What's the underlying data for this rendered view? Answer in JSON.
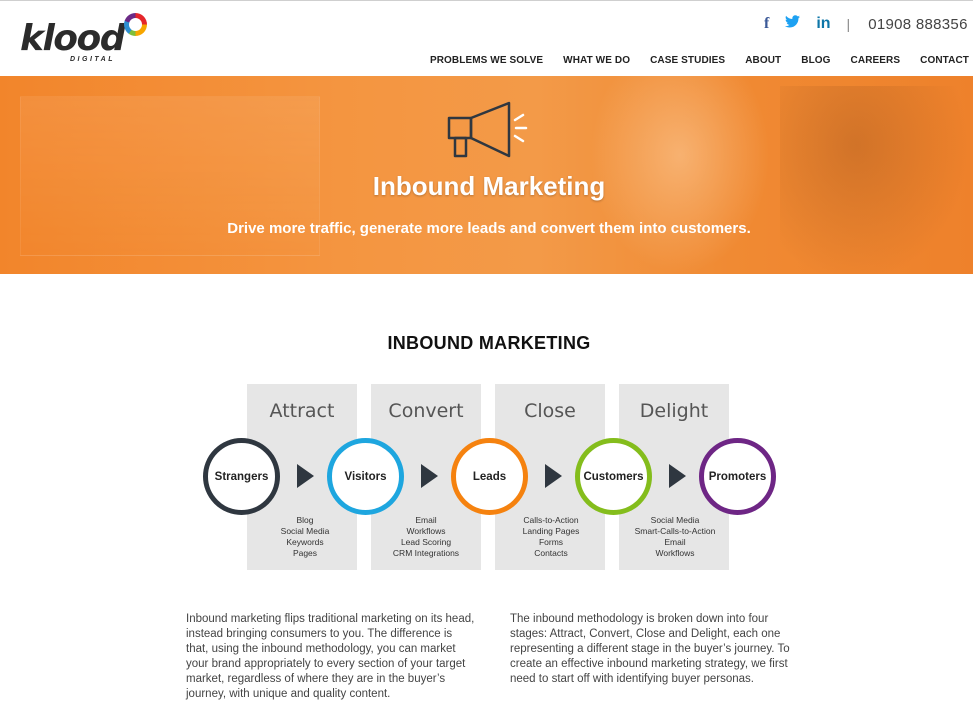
{
  "header": {
    "logo_text": "klood",
    "logo_sub": "DIGITAL",
    "social": [
      {
        "icon": "facebook-icon",
        "glyph": "f"
      },
      {
        "icon": "twitter-icon",
        "glyph": "🐦"
      },
      {
        "icon": "linkedin-icon",
        "glyph": "in"
      }
    ],
    "divider": "|",
    "phone": "01908 888356",
    "nav": [
      "PROBLEMS WE SOLVE",
      "WHAT WE DO",
      "CASE STUDIES",
      "ABOUT",
      "BLOG",
      "CAREERS",
      "CONTACT"
    ]
  },
  "hero": {
    "icon": "megaphone-icon",
    "title": "Inbound Marketing",
    "subtitle": "Drive more traffic, generate more leads and convert them into customers.",
    "color": "#f39a48"
  },
  "section": {
    "title": "INBOUND MARKETING",
    "stages": [
      {
        "label": "Attract",
        "items": [
          "Blog",
          "Social Media",
          "Keywords",
          "Pages"
        ]
      },
      {
        "label": "Convert",
        "items": [
          "Email",
          "Workflows",
          "Lead Scoring",
          "CRM Integrations"
        ]
      },
      {
        "label": "Close",
        "items": [
          "Calls-to-Action",
          "Landing Pages",
          "Forms",
          "Contacts"
        ]
      },
      {
        "label": "Delight",
        "items": [
          "Social Media",
          "Smart-Calls-to-Action",
          "Email",
          "Workflows"
        ]
      }
    ],
    "circles": [
      {
        "label": "Strangers",
        "color": "#2f3740"
      },
      {
        "label": "Visitors",
        "color": "#1ea6df"
      },
      {
        "label": "Leads",
        "color": "#f5820f"
      },
      {
        "label": "Customers",
        "color": "#84bd1c"
      },
      {
        "label": "Promoters",
        "color": "#6e2685"
      }
    ],
    "paragraphs": [
      "Inbound marketing flips traditional marketing on its head, instead bringing consumers to you. The difference is that, using the inbound methodology, you can market your brand appropriately to every section of your target market, regardless of where they are in the buyer’s journey, with unique and quality content.",
      "The inbound methodology is broken down into four stages: Attract, Convert, Close and Delight, each one representing a different stage in the buyer’s journey. To create an effective inbound marketing strategy, we first need to start off with identifying buyer personas."
    ]
  }
}
